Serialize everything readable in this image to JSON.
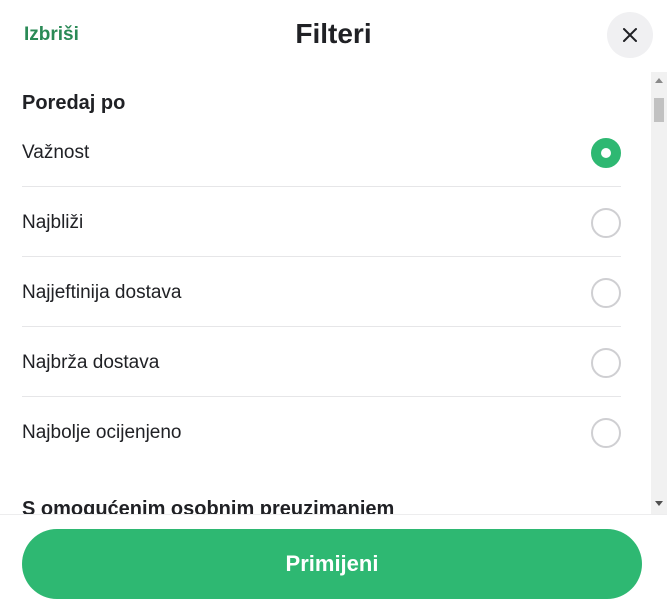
{
  "header": {
    "clear_label": "Izbriši",
    "title": "Filteri",
    "close_icon": "close-icon"
  },
  "sort": {
    "section_title": "Poredaj po",
    "options": [
      {
        "label": "Važnost",
        "selected": true
      },
      {
        "label": "Najbliži",
        "selected": false
      },
      {
        "label": "Najjeftinija dostava",
        "selected": false
      },
      {
        "label": "Najbrža dostava",
        "selected": false
      },
      {
        "label": "Najbolje ocijenjeno",
        "selected": false
      }
    ]
  },
  "next_section_title": "S omogućenim osobnim preuzimanjem",
  "footer": {
    "apply_label": "Primijeni"
  },
  "colors": {
    "accent": "#2eb872",
    "link": "#2a8a56",
    "text": "#202125"
  }
}
